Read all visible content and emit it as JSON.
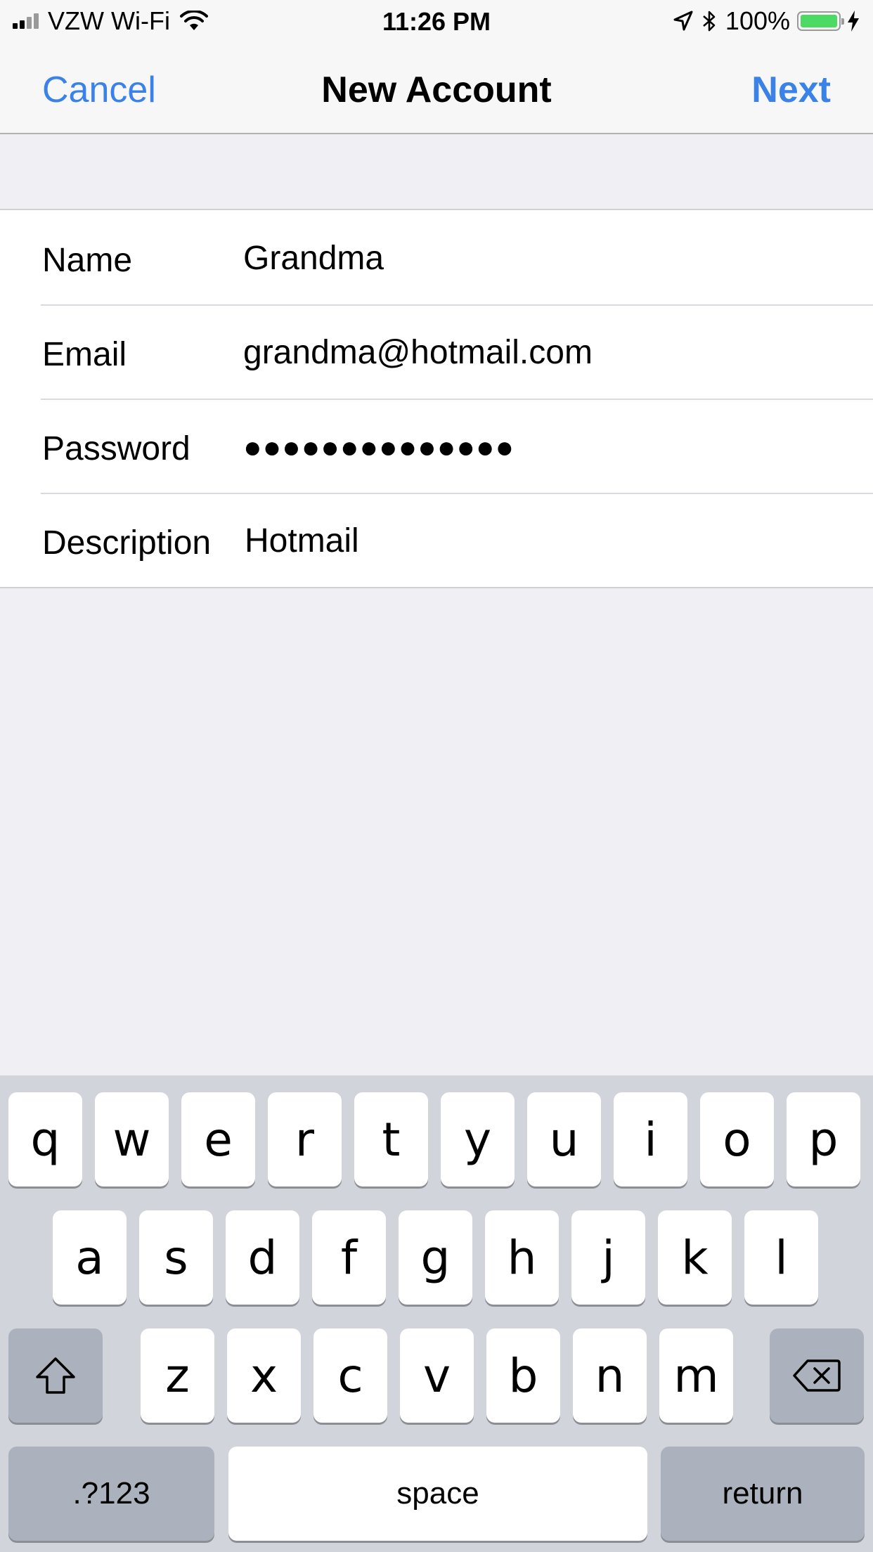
{
  "status_bar": {
    "carrier": "VZW Wi-Fi",
    "time": "11:26 PM",
    "battery_percent": "100%",
    "battery_level": 1.0,
    "battery_color": "#4cd964",
    "icons": [
      "signal-icon",
      "wifi-icon",
      "location-icon",
      "bluetooth-icon",
      "battery-icon",
      "charging-bolt-icon"
    ]
  },
  "nav": {
    "cancel_label": "Cancel",
    "title": "New Account",
    "next_label": "Next",
    "accent_color": "#3b82e8"
  },
  "form": {
    "rows": [
      {
        "label": "Name",
        "value": "Grandma"
      },
      {
        "label": "Email",
        "value": "grandma@hotmail.com"
      },
      {
        "label": "Password",
        "value": "●●●●●●●●●●●●●●"
      },
      {
        "label": "Description",
        "value": "Hotmail"
      }
    ]
  },
  "keyboard": {
    "row1": [
      "q",
      "w",
      "e",
      "r",
      "t",
      "y",
      "u",
      "i",
      "o",
      "p"
    ],
    "row2": [
      "a",
      "s",
      "d",
      "f",
      "g",
      "h",
      "j",
      "k",
      "l"
    ],
    "row3": [
      "z",
      "x",
      "c",
      "v",
      "b",
      "n",
      "m"
    ],
    "numbers_label": ".?123",
    "space_label": "space",
    "return_label": "return",
    "shift_icon": "shift-icon",
    "delete_icon": "delete-icon"
  }
}
